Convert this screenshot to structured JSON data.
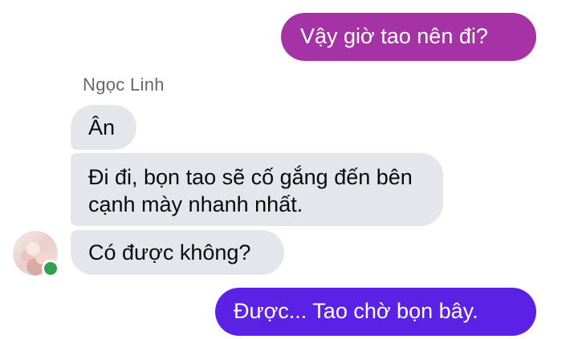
{
  "messages": {
    "outgoing_1": "Vậy giờ tao nên đi?",
    "sender_name": "Ngọc Linh",
    "incoming_1": "Ân",
    "incoming_2": "Đi đi, bọn tao sẽ cố gắng đến bên cạnh mày nhanh nhất.",
    "incoming_3": "Có được không?",
    "outgoing_2": "Được... Tao chờ bọn bây."
  },
  "colors": {
    "outgoing_gradient_top": "#a633a6",
    "outgoing_gradient_bottom": "#5b22e6",
    "incoming_bubble": "#e4e6eb",
    "presence_online": "#31a24c",
    "sender_name_text": "#65676b"
  },
  "icons": {
    "avatar": "contact-avatar",
    "presence": "online-status-dot"
  }
}
